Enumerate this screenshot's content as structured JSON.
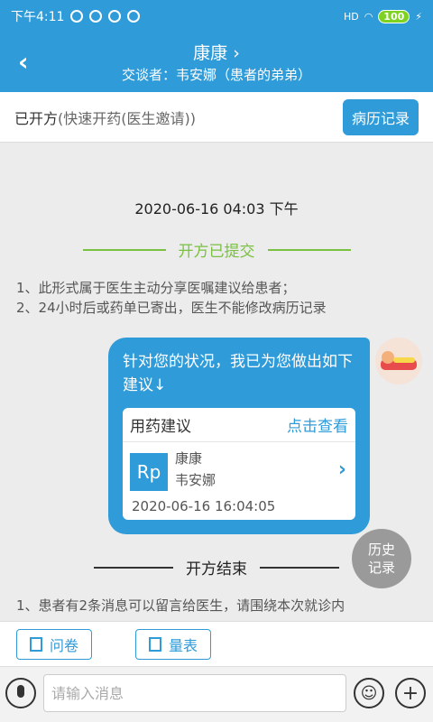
{
  "status": {
    "time": "下午4:11",
    "signal": "HD",
    "battery": "100"
  },
  "header": {
    "title": "康康 ›",
    "subtitle": "交谈者：韦安娜（患者的弟弟）"
  },
  "infobar": {
    "status": "已开方",
    "detail": "(快速开药(医生邀请))",
    "records_button": "病历记录"
  },
  "chat": {
    "timestamp": "2020-06-16 04:03 下午",
    "submitted_label": "开方已提交",
    "notices": [
      "1、此形式属于医生主动分享医嘱建议给患者；",
      "2、24小时后或药单已寄出，医生不能修改病历记录"
    ],
    "bubble": {
      "text": "针对您的状况，我已为您做出如下建议↓",
      "card_title": "用药建议",
      "card_link": "点击查看",
      "rp": "Rp",
      "patient": "康康",
      "doctor": "韦安娜",
      "time": "2020-06-16 16:04:05"
    },
    "history_line1": "历史",
    "history_line2": "记录",
    "end_label": "开方结束",
    "tip": "1、患者有2条消息可以留言给医生，请围绕本次就诊内"
  },
  "toolbar": {
    "questionnaire": "问卷",
    "scale": "量表"
  },
  "input": {
    "placeholder": "请输入消息"
  },
  "colors": {
    "primary": "#2f9bd9",
    "green": "#7ac143"
  }
}
